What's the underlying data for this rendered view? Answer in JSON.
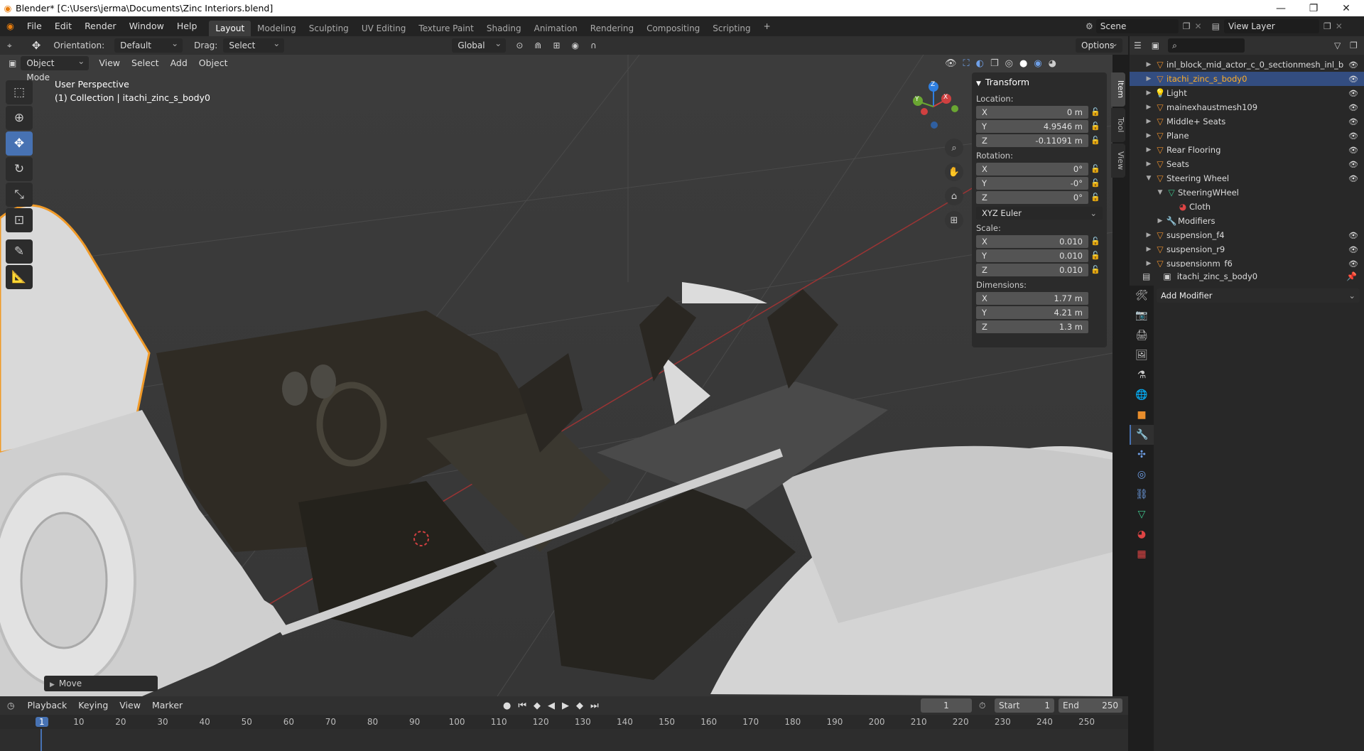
{
  "window": {
    "title": "Blender* [C:\\Users\\jerma\\Documents\\Zinc Interiors.blend]"
  },
  "menu": [
    "File",
    "Edit",
    "Render",
    "Window",
    "Help"
  ],
  "workspaces": [
    "Layout",
    "Modeling",
    "Sculpting",
    "UV Editing",
    "Texture Paint",
    "Shading",
    "Animation",
    "Rendering",
    "Compositing",
    "Scripting"
  ],
  "scene": {
    "name": "Scene",
    "view_layer": "View Layer"
  },
  "tool_header": {
    "orientation_label": "Orientation:",
    "orientation_value": "Default",
    "drag_label": "Drag:",
    "drag_value": "Select Box",
    "transform_space": "Global",
    "options": "Options"
  },
  "viewport_header": {
    "mode": "Object Mode",
    "items": [
      "View",
      "Select",
      "Add",
      "Object"
    ]
  },
  "viewport": {
    "perspective": "User Perspective",
    "collection": "(1) Collection | itachi_zinc_s_body0",
    "last_op": "Move"
  },
  "gizmo": {
    "x": "X",
    "y": "Y",
    "z": "Z"
  },
  "transform": {
    "title": "Transform",
    "location_label": "Location:",
    "rotation_label": "Rotation:",
    "scale_label": "Scale:",
    "dimensions_label": "Dimensions:",
    "rotation_mode": "XYZ Euler",
    "location": [
      {
        "axis": "X",
        "value": "0 m"
      },
      {
        "axis": "Y",
        "value": "4.9546 m"
      },
      {
        "axis": "Z",
        "value": "-0.11091 m"
      }
    ],
    "rotation": [
      {
        "axis": "X",
        "value": "0°"
      },
      {
        "axis": "Y",
        "value": "-0°"
      },
      {
        "axis": "Z",
        "value": "0°"
      }
    ],
    "scale": [
      {
        "axis": "X",
        "value": "0.010"
      },
      {
        "axis": "Y",
        "value": "0.010"
      },
      {
        "axis": "Z",
        "value": "0.010"
      }
    ],
    "dimensions": [
      {
        "axis": "X",
        "value": "1.77 m"
      },
      {
        "axis": "Y",
        "value": "4.21 m"
      },
      {
        "axis": "Z",
        "value": "1.3 m"
      }
    ]
  },
  "npanel_tabs": [
    "Item",
    "Tool",
    "View"
  ],
  "outliner": {
    "rows": [
      {
        "name": "inl_block_mid_actor_c_0_sectionmesh_inl_b",
        "indent": 0
      },
      {
        "name": "itachi_zinc_s_body0",
        "indent": 0,
        "selected": true
      },
      {
        "name": "Light",
        "indent": 0
      },
      {
        "name": "mainexhaustmesh109",
        "indent": 0
      },
      {
        "name": "Middle+ Seats",
        "indent": 0
      },
      {
        "name": "Plane",
        "indent": 0
      },
      {
        "name": "Rear Flooring",
        "indent": 0
      },
      {
        "name": "Seats",
        "indent": 0
      },
      {
        "name": "Steering Wheel",
        "indent": 0,
        "expanded": true
      },
      {
        "name": "SteeringWHeel",
        "indent": 1
      },
      {
        "name": "Cloth",
        "indent": 2
      },
      {
        "name": "Modifiers",
        "indent": 1
      },
      {
        "name": "suspension_f4",
        "indent": 0
      },
      {
        "name": "suspension_r9",
        "indent": 0
      },
      {
        "name": "suspensionm_f6",
        "indent": 0
      }
    ]
  },
  "properties": {
    "object_name": "itachi_zinc_s_body0",
    "add_modifier": "Add Modifier"
  },
  "timeline": {
    "menus": [
      "Playback",
      "Keying",
      "View",
      "Marker"
    ],
    "current_frame": "1",
    "start_label": "Start",
    "start": "1",
    "end_label": "End",
    "end": "250",
    "ticks": [
      "1",
      "10",
      "20",
      "30",
      "40",
      "50",
      "60",
      "70",
      "80",
      "90",
      "100",
      "110",
      "120",
      "130",
      "140",
      "150",
      "160",
      "170",
      "180",
      "190",
      "200",
      "210",
      "220",
      "230",
      "240",
      "250"
    ]
  }
}
